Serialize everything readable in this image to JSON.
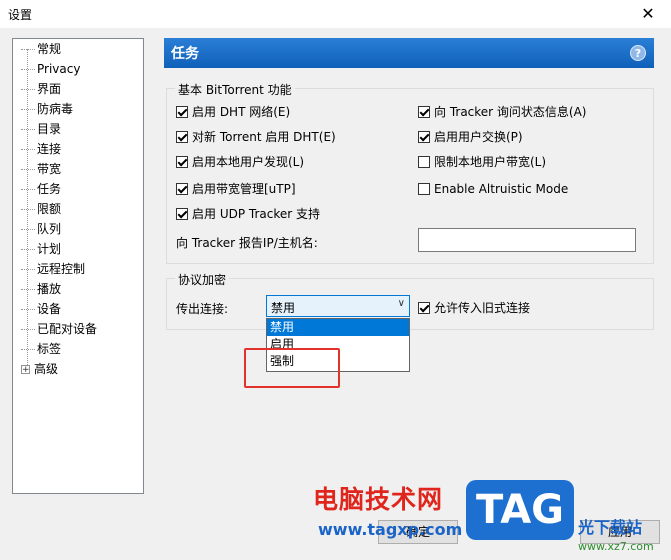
{
  "window": {
    "title": "设置",
    "close_symbol": "✕"
  },
  "tree": {
    "items": [
      {
        "label": "常规"
      },
      {
        "label": "Privacy"
      },
      {
        "label": "界面"
      },
      {
        "label": "防病毒"
      },
      {
        "label": "目录"
      },
      {
        "label": "连接"
      },
      {
        "label": "带宽"
      },
      {
        "label": "任务"
      },
      {
        "label": "限额"
      },
      {
        "label": "队列"
      },
      {
        "label": "计划"
      },
      {
        "label": "远程控制"
      },
      {
        "label": "播放"
      },
      {
        "label": "设备"
      },
      {
        "label": "已配对设备"
      },
      {
        "label": "标签"
      }
    ],
    "advanced": {
      "expander": "+",
      "label": "高级"
    }
  },
  "panel": {
    "title": "任务",
    "help_symbol": "?"
  },
  "basic": {
    "group_label": "基本 BitTorrent 功能",
    "left": [
      {
        "label": "启用 DHT 网络(E)",
        "checked": true
      },
      {
        "label": "对新 Torrent 启用 DHT(E)",
        "checked": true
      },
      {
        "label": "启用本地用户发现(L)",
        "checked": true
      },
      {
        "label": "启用带宽管理[uTP]",
        "checked": true
      },
      {
        "label": "启用 UDP Tracker 支持",
        "checked": true
      }
    ],
    "right": [
      {
        "label": "向 Tracker 询问状态信息(A)",
        "checked": true
      },
      {
        "label": "启用用户交换(P)",
        "checked": true
      },
      {
        "label": "限制本地用户带宽(L)",
        "checked": false
      },
      {
        "label": "Enable Altruistic Mode",
        "checked": false
      }
    ],
    "report_label": "向 Tracker 报告IP/主机名:",
    "report_value": ""
  },
  "encryption": {
    "group_label": "协议加密",
    "outgoing_label": "传出连接:",
    "selected": "禁用",
    "chevron": "∨",
    "options": [
      "禁用",
      "启用",
      "强制"
    ],
    "allow_legacy": {
      "label": "允许传入旧式连接",
      "checked": true
    }
  },
  "buttons": {
    "ok": "确定",
    "apply": "应用"
  },
  "watermark": {
    "cn": "电脑技术网",
    "url": "www.tagxp.com",
    "logo": "TAG",
    "xz": "光下载站",
    "xz_url": "www.xz7.com"
  },
  "colors": {
    "header": "#1565c0",
    "accent": "#0078d7",
    "highlight_box": "#e3322b"
  }
}
